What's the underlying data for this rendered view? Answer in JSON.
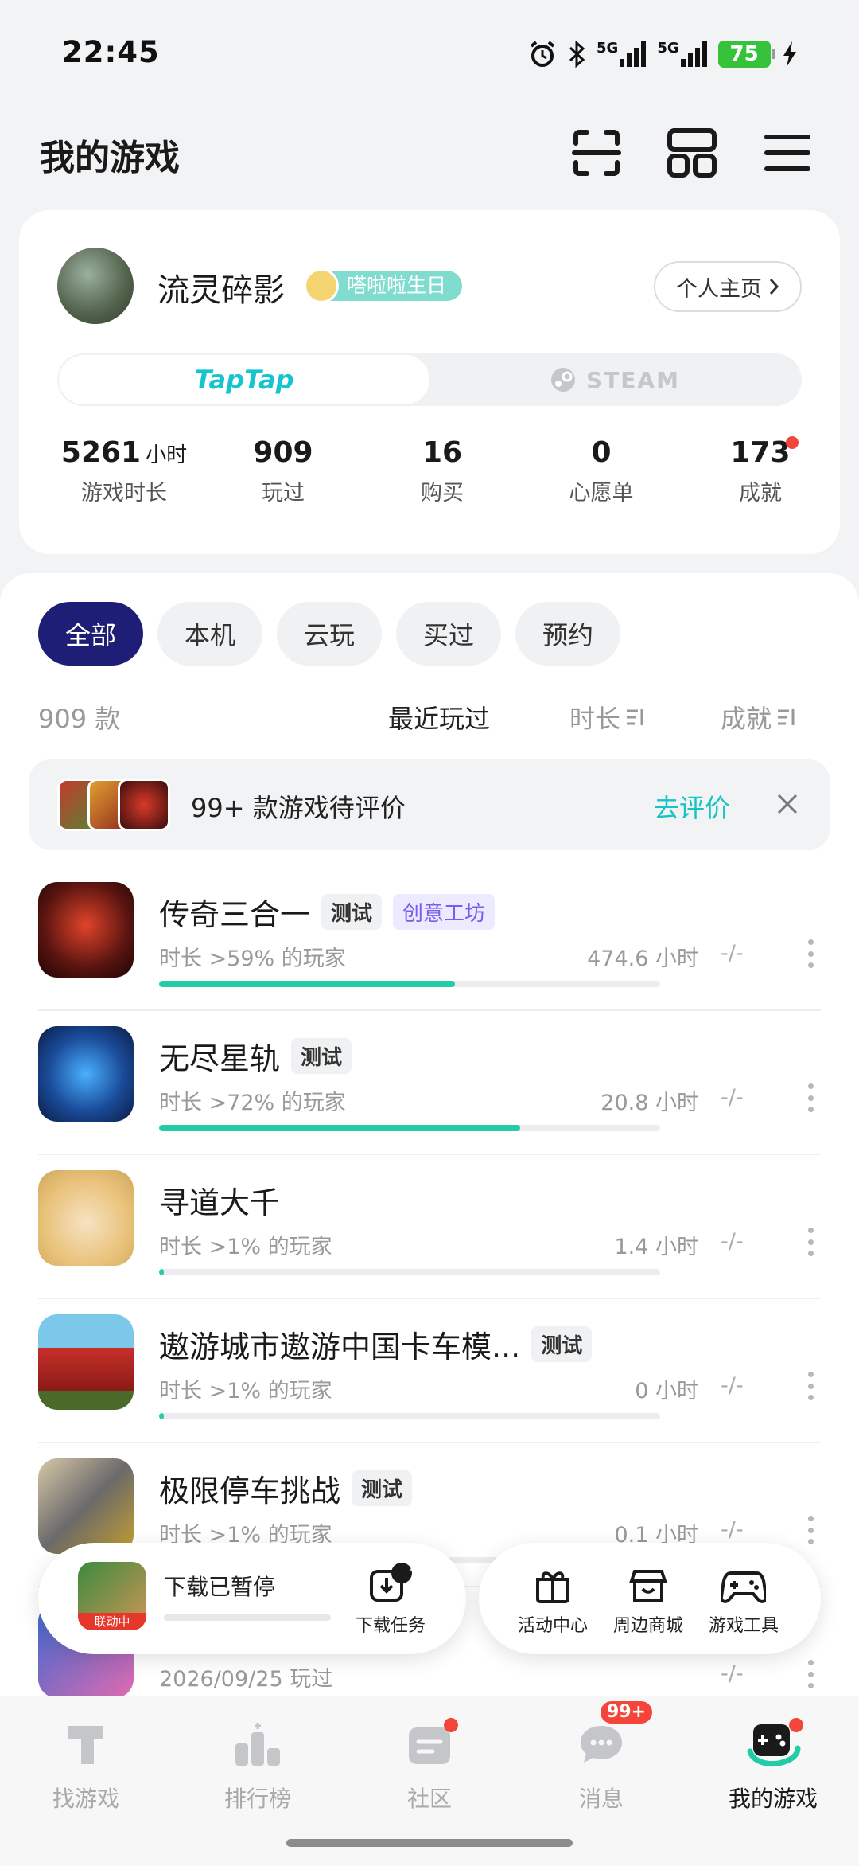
{
  "status_bar": {
    "time": "22:45",
    "network_1": "5G",
    "network_2": "5G",
    "battery": "75"
  },
  "header": {
    "title": "我的游戏",
    "icons": [
      "scan-icon",
      "grid-icon",
      "menu-icon"
    ]
  },
  "profile": {
    "username": "流灵碎影",
    "badge": "嗒啦啦生日",
    "profile_link": "个人主页",
    "platforms": {
      "active": "TapTap",
      "inactive": "STEAM"
    },
    "stats": [
      {
        "value": "5261",
        "unit": "小时",
        "label": "游戏时长"
      },
      {
        "value": "909",
        "label": "玩过"
      },
      {
        "value": "16",
        "label": "购买"
      },
      {
        "value": "0",
        "label": "心愿单"
      },
      {
        "value": "173",
        "label": "成就"
      }
    ]
  },
  "filters": {
    "chips": [
      "全部",
      "本机",
      "云玩",
      "买过",
      "预约"
    ],
    "active": "全部"
  },
  "list_header": {
    "count": "909 款",
    "sort_recent": "最近玩过",
    "sort_duration": "时长",
    "sort_achievement": "成就"
  },
  "rate_banner": {
    "text": "99+ 款游戏待评价",
    "cta": "去评价"
  },
  "games": [
    {
      "name": "传奇三合一",
      "tags": [
        "测试",
        "创意工坊"
      ],
      "subtitle": "时长 >59% 的玩家",
      "hours": "474.6 小时",
      "progress": 0.59,
      "achievement": "-/-"
    },
    {
      "name": "无尽星轨",
      "tags": [
        "测试"
      ],
      "subtitle": "时长 >72% 的玩家",
      "hours": "20.8 小时",
      "progress": 0.72,
      "achievement": "-/-"
    },
    {
      "name": "寻道大千",
      "tags": [],
      "subtitle": "时长 >1% 的玩家",
      "hours": "1.4 小时",
      "progress": 0.01,
      "achievement": "-/-"
    },
    {
      "name": "遨游城市遨游中国卡车模...",
      "tags": [
        "测试"
      ],
      "subtitle": "时长 >1% 的玩家",
      "hours": "0 小时",
      "progress": 0.01,
      "achievement": "-/-"
    },
    {
      "name": "极限停车挑战",
      "tags": [
        "测试"
      ],
      "subtitle": "时长 >1% 的玩家",
      "hours": "0.1 小时",
      "progress": 0.01,
      "achievement": "-/-"
    },
    {
      "name": "",
      "tags": [],
      "subtitle": "2026/09/25 玩过",
      "hours": "",
      "progress": 0,
      "achievement": "-/-"
    }
  ],
  "download": {
    "status": "下载已暂停",
    "icon_badge": "联动中",
    "tasks_label": "下载任务",
    "tasks_count": "1"
  },
  "tools": [
    "活动中心",
    "周边商城",
    "游戏工具"
  ],
  "tabs": [
    {
      "label": "找游戏"
    },
    {
      "label": "排行榜"
    },
    {
      "label": "社区"
    },
    {
      "label": "消息",
      "badge": "99+"
    },
    {
      "label": "我的游戏"
    }
  ],
  "colors": {
    "accent": "#16c4c4",
    "progress": "#22cda6",
    "chip_active": "#1e1e76",
    "notify": "#f4453a"
  }
}
